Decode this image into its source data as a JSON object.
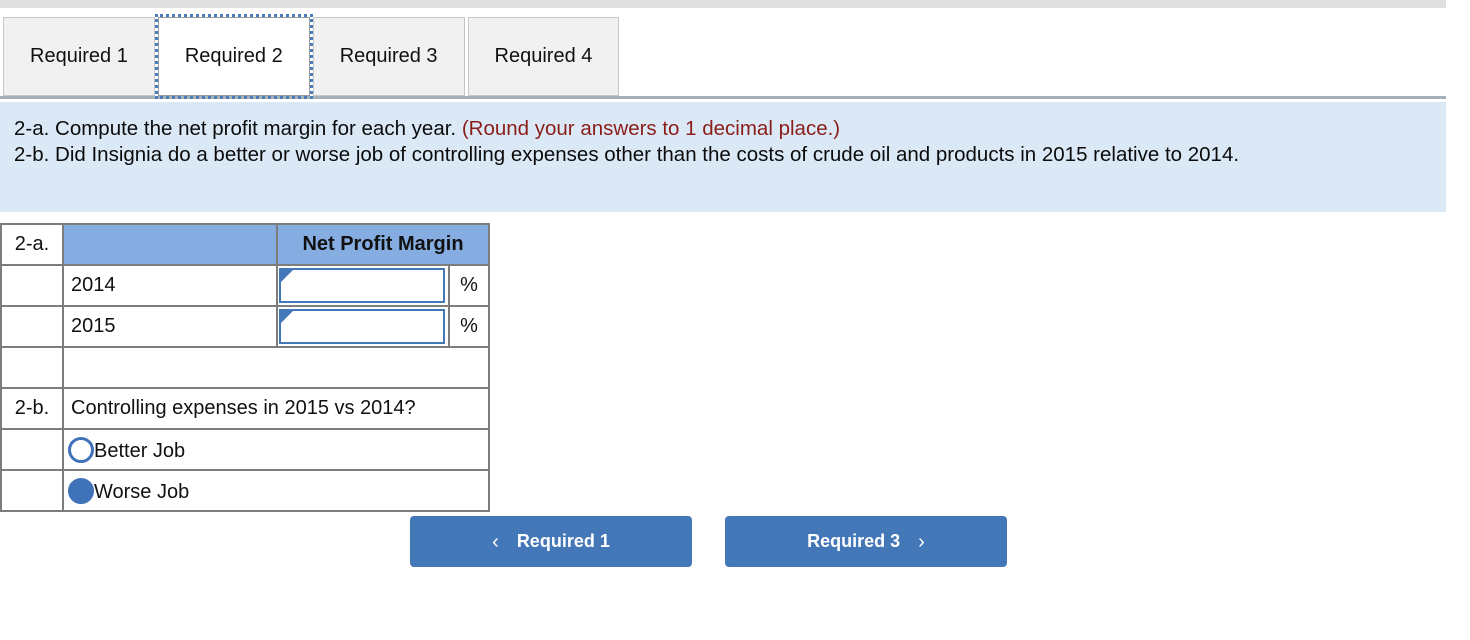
{
  "tabs": [
    {
      "label": "Required 1",
      "active": false
    },
    {
      "label": "Required 2",
      "active": true
    },
    {
      "label": "Required 3",
      "active": false
    },
    {
      "label": "Required 4",
      "active": false
    }
  ],
  "instructions": {
    "line1_text": "2-a. Compute the net profit margin for each year. ",
    "line1_note": "(Round your answers to 1 decimal place.)",
    "line2": "2-b. Did Insignia do a better or worse job of controlling expenses other than the costs of crude oil and products in 2015 relative to 2014."
  },
  "table": {
    "part_a_label": "2-a.",
    "part_b_label": "2-b.",
    "blank_header": "",
    "column_header": "Net Profit Margin",
    "percent_symbol": "%",
    "rows": [
      {
        "year": "2014",
        "value": "",
        "placeholder": ""
      },
      {
        "year": "2015",
        "value": "",
        "placeholder": ""
      }
    ],
    "question": "Controlling expenses in 2015 vs 2014?",
    "options": [
      {
        "label": "Better Job",
        "selected": false
      },
      {
        "label": "Worse Job",
        "selected": true
      }
    ]
  },
  "navigation": {
    "prev_label": "Required 1",
    "prev_icon": "chevron-left-icon",
    "prev_chevron": "‹",
    "next_label": "Required 3",
    "next_icon": "chevron-right-icon",
    "next_chevron": "›"
  },
  "colors": {
    "accent_blue": "#4477b8",
    "header_blue": "#85ade2",
    "panel_blue": "#dbe9f7",
    "note_red": "#8b1d19",
    "border_gray": "#7d7d7d"
  }
}
